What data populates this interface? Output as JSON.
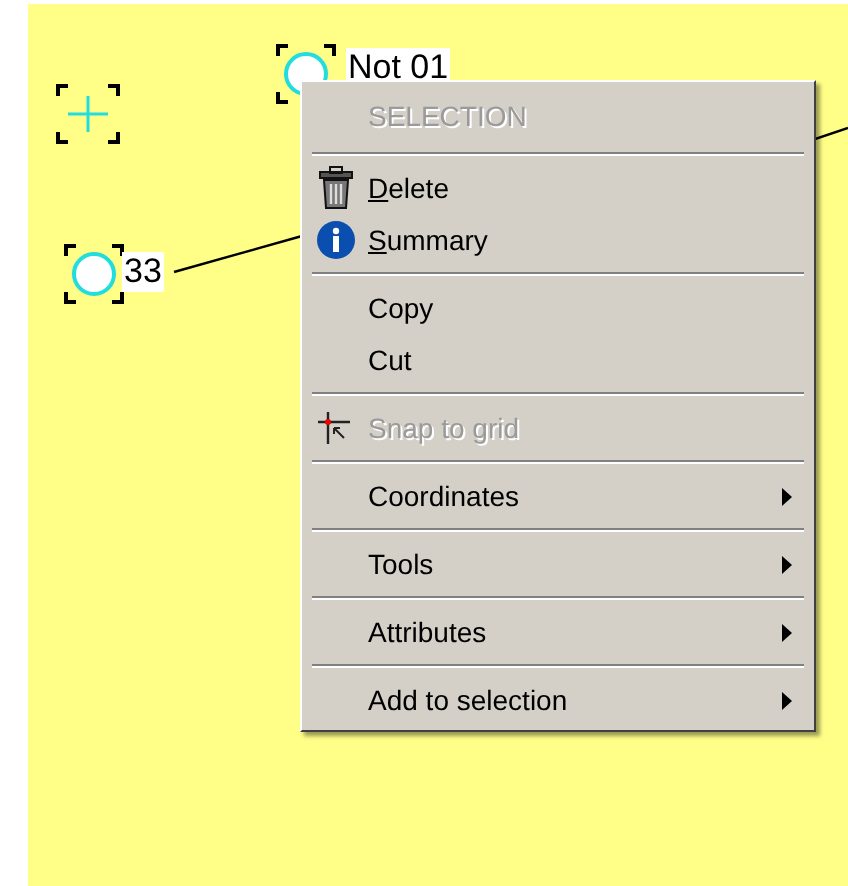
{
  "canvas": {
    "nodes": [
      {
        "kind": "crosshair"
      },
      {
        "kind": "node",
        "label": "Not 01"
      },
      {
        "kind": "node",
        "label": "33"
      }
    ]
  },
  "context_menu": {
    "items": [
      {
        "kind": "header",
        "label": "SELECTION"
      },
      {
        "kind": "separator"
      },
      {
        "kind": "trash",
        "label": "Delete",
        "underline_first": true,
        "disabled": false,
        "submenu": false
      },
      {
        "kind": "info",
        "label": "Summary",
        "underline_first": true,
        "disabled": false,
        "submenu": false
      },
      {
        "kind": "separator"
      },
      {
        "kind": "item",
        "label": "Copy",
        "underline_first": false,
        "disabled": false,
        "submenu": false
      },
      {
        "kind": "item",
        "label": "Cut",
        "underline_first": false,
        "disabled": false,
        "submenu": false
      },
      {
        "kind": "separator"
      },
      {
        "kind": "snap",
        "label": "Snap to grid",
        "underline_first": false,
        "disabled": true,
        "submenu": false
      },
      {
        "kind": "separator"
      },
      {
        "kind": "item",
        "label": "Coordinates",
        "underline_first": false,
        "disabled": false,
        "submenu": true
      },
      {
        "kind": "separator"
      },
      {
        "kind": "item",
        "label": "Tools",
        "underline_first": false,
        "disabled": false,
        "submenu": true
      },
      {
        "kind": "separator"
      },
      {
        "kind": "item",
        "label": "Attributes",
        "underline_first": false,
        "disabled": false,
        "submenu": true
      },
      {
        "kind": "separator"
      },
      {
        "kind": "item",
        "label": "Add to selection",
        "underline_first": false,
        "disabled": false,
        "submenu": true
      }
    ]
  }
}
